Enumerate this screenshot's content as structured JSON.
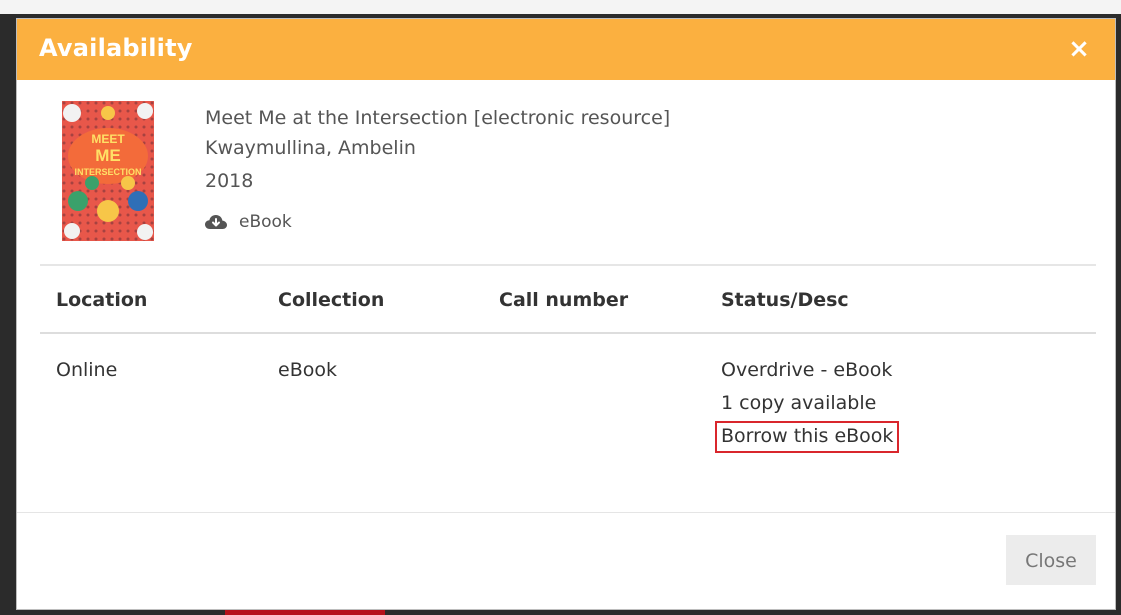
{
  "dialog": {
    "title": "Availability",
    "close_icon": "×",
    "icon_name": "close-icon"
  },
  "record": {
    "title": "Meet Me at the Intersection [electronic resource]",
    "author": "Kwaymullina, Ambelin",
    "year": "2018",
    "format_label": "eBook",
    "format_icon": "cloud-download-icon",
    "cover_text": [
      "MEET",
      "ME",
      "INTERSECTION"
    ]
  },
  "table": {
    "headers": [
      "Location",
      "Collection",
      "Call number",
      "Status/Desc"
    ],
    "rows": [
      {
        "location": "Online",
        "collection": "eBook",
        "call_number": "",
        "status_lines": [
          "Overdrive - eBook",
          "1 copy available"
        ],
        "action_label": "Borrow this eBook"
      }
    ]
  },
  "footer": {
    "close_label": "Close"
  },
  "colors": {
    "header_bg": "#fbb040",
    "highlight_border": "#d9262c"
  }
}
